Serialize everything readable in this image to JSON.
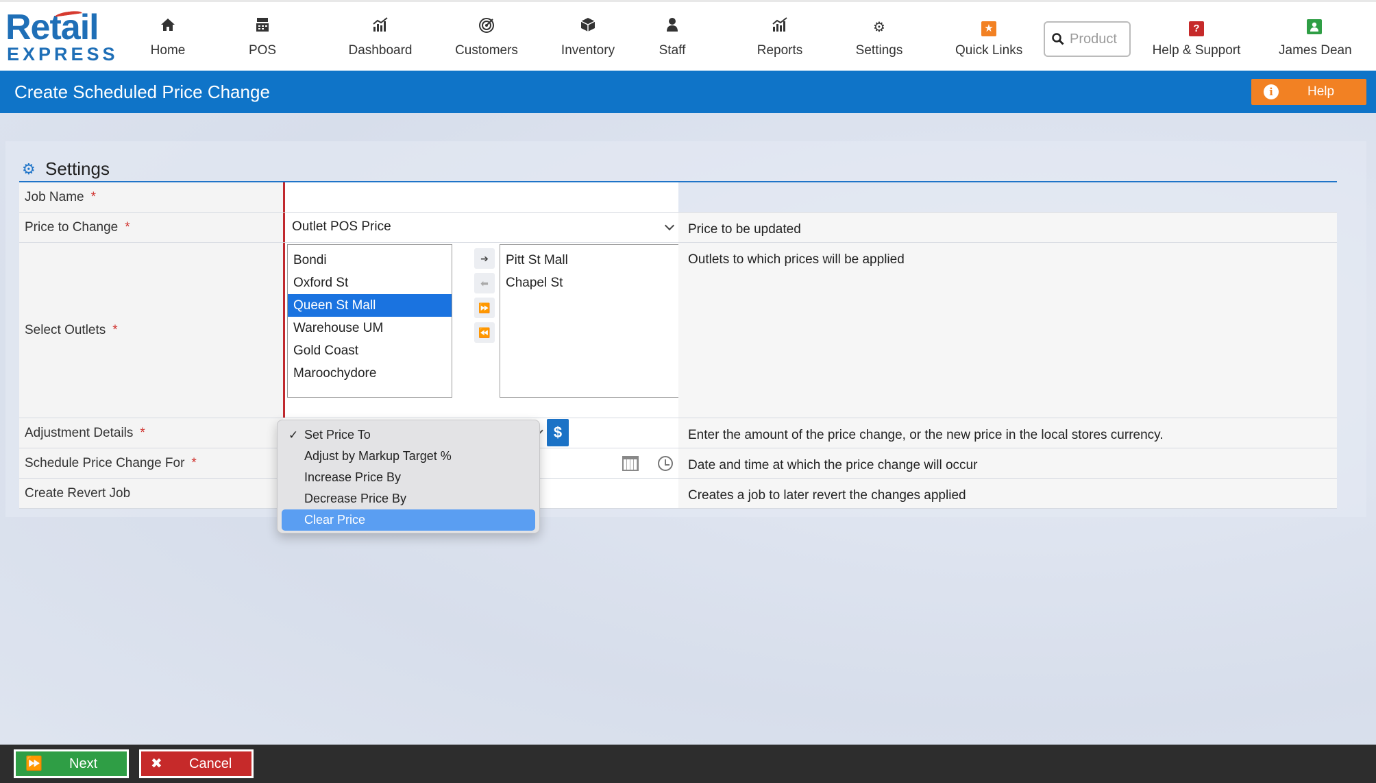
{
  "brand": {
    "line1": "Retail",
    "line2": "EXPRESS"
  },
  "nav": {
    "items": [
      {
        "label": "Home",
        "icon": "home-icon"
      },
      {
        "label": "POS",
        "icon": "register-icon"
      },
      {
        "label": "Dashboard",
        "icon": "bar-chart-icon"
      },
      {
        "label": "Customers",
        "icon": "target-icon"
      },
      {
        "label": "Inventory",
        "icon": "box-icon"
      },
      {
        "label": "Staff",
        "icon": "person-icon"
      },
      {
        "label": "Reports",
        "icon": "bar-chart-icon"
      },
      {
        "label": "Settings",
        "icon": "gear-icon"
      },
      {
        "label": "Quick Links",
        "icon": "star-icon"
      },
      {
        "label": "Help & Support",
        "icon": "question-icon"
      },
      {
        "label": "James Dean",
        "icon": "user-icon"
      }
    ],
    "search_placeholder": "Product"
  },
  "titlebar": {
    "title": "Create Scheduled Price Change",
    "help_label": "Help"
  },
  "section": {
    "title": "Settings"
  },
  "form": {
    "job_name": {
      "label": "Job Name",
      "required": "*",
      "value": ""
    },
    "price_to_change": {
      "label": "Price to Change",
      "required": "*",
      "value": "Outlet POS Price",
      "description": "Price to be updated"
    },
    "select_outlets": {
      "label": "Select Outlets",
      "required": "*",
      "description": "Outlets to which prices will be applied",
      "available": [
        "Bondi",
        "Oxford St",
        "Queen St Mall",
        "Warehouse UM",
        "Gold Coast",
        "Maroochydore"
      ],
      "selected_available_index": 2,
      "selected": [
        "Pitt St Mall",
        "Chapel St"
      ]
    },
    "adjustment_details": {
      "label": "Adjustment Details",
      "required": "*",
      "currency_symbol": "$",
      "description": "Enter the amount of the price change, or the new price in the local stores currency."
    },
    "schedule": {
      "label": "Schedule Price Change For",
      "required": "*",
      "description": "Date and time at which the price change will occur"
    },
    "revert": {
      "label": "Create Revert Job",
      "description": "Creates a job to later revert the changes applied"
    }
  },
  "adjustment_dropdown": {
    "options": [
      "Set Price To",
      "Adjust by Markup Target %",
      "Increase Price By",
      "Decrease Price By",
      "Clear Price"
    ],
    "checked_index": 0,
    "highlighted_index": 4,
    "check_mark": "✓"
  },
  "footer": {
    "next_label": "Next",
    "cancel_label": "Cancel"
  },
  "colors": {
    "brand_blue": "#0f74c8",
    "help_orange": "#f28123",
    "required_red": "#d0312d",
    "next_green": "#2f9e45",
    "cancel_red": "#c62a2a"
  }
}
